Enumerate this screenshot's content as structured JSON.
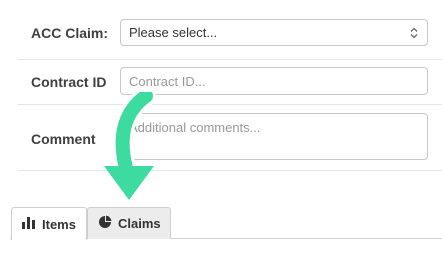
{
  "form": {
    "acc_claim": {
      "label": "ACC Claim:",
      "value": "Please select..."
    },
    "contract_id": {
      "label": "Contract ID",
      "placeholder": "Contract ID..."
    },
    "comment": {
      "label": "Comment",
      "placeholder": "Additional comments..."
    }
  },
  "tabs": [
    {
      "label": "Items",
      "icon": "bar-chart-icon",
      "active": true
    },
    {
      "label": "Claims",
      "icon": "pie-chart-icon",
      "active": false
    }
  ],
  "annotation": {
    "icon": "curved-down-arrow-icon",
    "color": "#3ddba0"
  }
}
